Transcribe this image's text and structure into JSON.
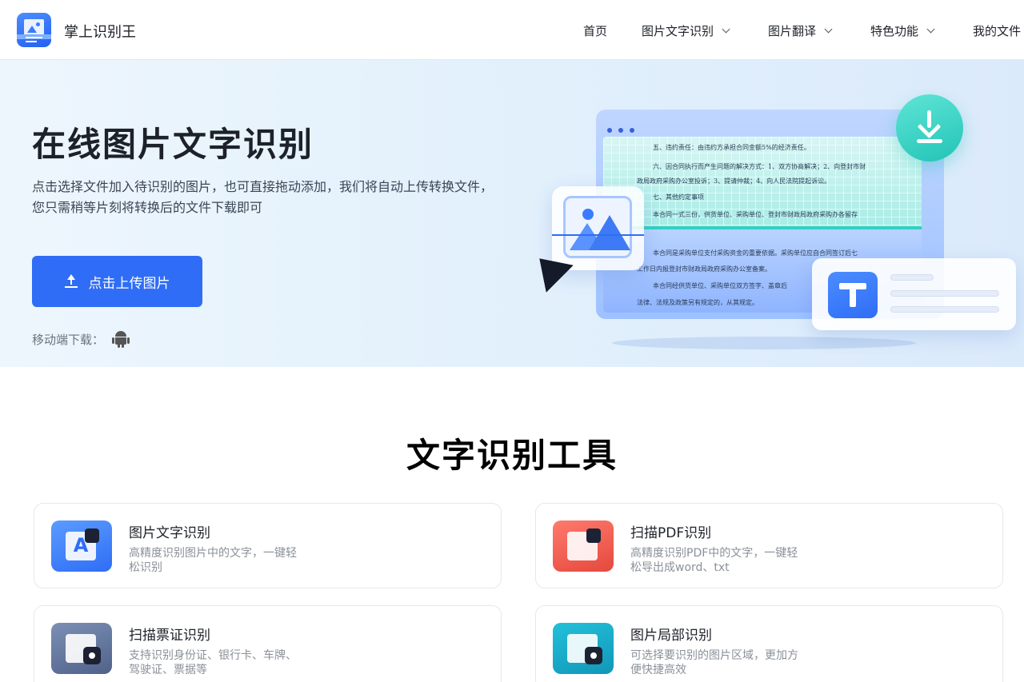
{
  "header": {
    "brand": "掌上识别王",
    "nav": [
      {
        "label": "首页",
        "has_dropdown": false
      },
      {
        "label": "图片文字识别",
        "has_dropdown": true
      },
      {
        "label": "图片翻译",
        "has_dropdown": true
      },
      {
        "label": "特色功能",
        "has_dropdown": true
      },
      {
        "label": "我的文件",
        "has_dropdown": false
      }
    ]
  },
  "hero": {
    "title": "在线图片文字识别",
    "desc_line1": "点击选择文件加入待识别的图片，也可直接拖动添加，我们将自动上传转换文件，",
    "desc_line2": "您只需稍等片刻将转换后的文件下载即可",
    "upload_label": "点击上传图片",
    "mobile_label": "移动端下载：",
    "doc_lines": [
      "五、违约责任：由违约方承担合同金额5%的经济责任。",
      "六、因合同执行而产生问题的解决方式：1、双方协商解决；2、向登封市财",
      "政局政府采购办公室投诉；3、提请仲裁；4、向人民法院提起诉讼。",
      "七、其他约定事项",
      "本合同一式三份，供货单位、采购单位、登封市财政局政府采购办各留存",
      "本合同是采购单位支付采购资金的重要依据。采购单位应自合同签订后七",
      "工作日内报登封市财政局政府采购办公室备案。",
      "本合同经供货单位、采购单位双方签字、盖章后",
      "法律、法规及政策另有规定的，从其规定。"
    ]
  },
  "tools": {
    "title": "文字识别工具",
    "items": [
      {
        "name": "图片文字识别",
        "desc_line1": "高精度识别图片中的文字，一键轻",
        "desc_line2": "松识别"
      },
      {
        "name": "扫描PDF识别",
        "desc_line1": "高精度识别PDF中的文字，一键轻",
        "desc_line2": "松导出成word、txt"
      },
      {
        "name": "扫描票证识别",
        "desc_line1": "支持识别身份证、银行卡、车牌、",
        "desc_line2": "驾驶证、票据等"
      },
      {
        "name": "图片局部识别",
        "desc_line1": "可选择要识别的图片区域，更加方",
        "desc_line2": "便快捷高效"
      }
    ]
  },
  "colors": {
    "primary": "#2f6df6",
    "teal_accent": "#22c4b6",
    "text_dark": "#1d2129",
    "text_muted": "#8a9099"
  },
  "icons": [
    "logo-icon",
    "chevron-down-icon",
    "upload-icon",
    "android-icon",
    "download-icon",
    "image-icon",
    "cursor-icon",
    "text-t-icon"
  ]
}
